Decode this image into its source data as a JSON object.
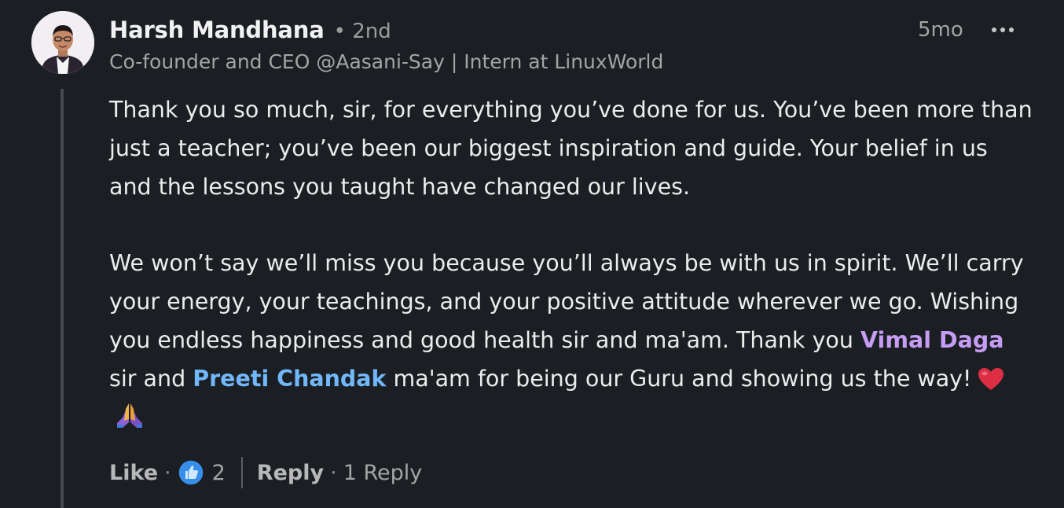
{
  "author": {
    "name": "Harsh Mandhana",
    "degree": "• 2nd",
    "headline": "Co-founder and CEO @Aasani-Say | Intern at LinuxWorld"
  },
  "timestamp": "5mo",
  "more_icon": "ellipsis-icon",
  "comment": {
    "paragraph1": "Thank you so much, sir, for everything you’ve done for us. You’ve been more than just a teacher; you’ve been our biggest inspiration and guide. Your belief in us and the lessons you taught have changed our lives.",
    "p2_text1": "We won’t say we’ll miss you because you’ll always be with us in spirit. We’ll carry your energy, your teachings, and your positive attitude wherever we go. Wishing you endless happiness and good health sir and ma'am. Thank you ",
    "mention1": "Vimal Daga",
    "p2_text2": " sir and ",
    "mention2": "Preeti Chandak",
    "p2_text3": " ma'am for being our Guru and showing us the way!",
    "emojis": [
      "heart-emoji",
      "folded-hands-emoji"
    ]
  },
  "actions": {
    "like_label": "Like",
    "sep": "·",
    "reaction_icon": "thumbs-up-icon",
    "like_count": "2",
    "reply_label": "Reply",
    "replies_text": "1 Reply"
  },
  "colors": {
    "background": "#1b1f23",
    "mention_purple": "#c79cf5",
    "mention_blue": "#71b7fb",
    "like_blue": "#378fe9"
  }
}
